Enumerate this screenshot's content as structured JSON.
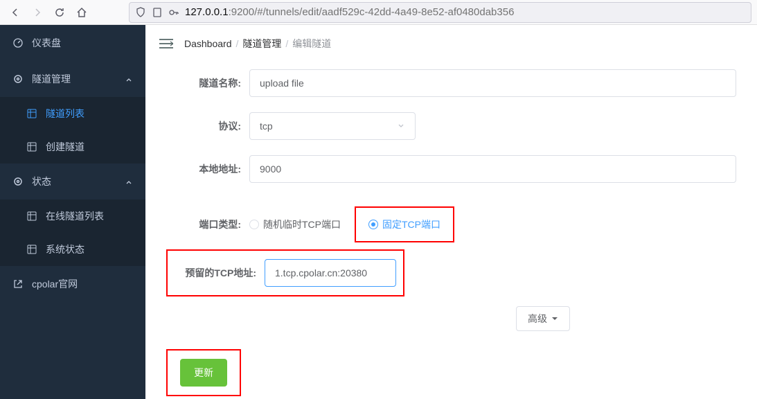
{
  "browser": {
    "url_prefix": "127.0.0.1",
    "url_rest": ":9200/#/tunnels/edit/aadf529c-42dd-4a49-8e52-af0480dab356"
  },
  "sidebar": {
    "dashboard": "仪表盘",
    "tunnel_mgmt": "隧道管理",
    "tunnel_list": "隧道列表",
    "create_tunnel": "创建隧道",
    "status": "状态",
    "online_list": "在线隧道列表",
    "sys_status": "系统状态",
    "website": "cpolar官网"
  },
  "breadcrumb": {
    "dashboard": "Dashboard",
    "tunnel_mgmt": "隧道管理",
    "edit_tunnel": "编辑隧道"
  },
  "form": {
    "name_label": "隧道名称:",
    "name_value": "upload file",
    "protocol_label": "协议:",
    "protocol_value": "tcp",
    "local_label": "本地地址:",
    "local_value": "9000",
    "port_type_label": "端口类型:",
    "port_random": "随机临时TCP端口",
    "port_fixed": "固定TCP端口",
    "reserved_label": "预留的TCP地址:",
    "reserved_value": "1.tcp.cpolar.cn:20380",
    "advanced": "高级",
    "submit": "更新"
  }
}
